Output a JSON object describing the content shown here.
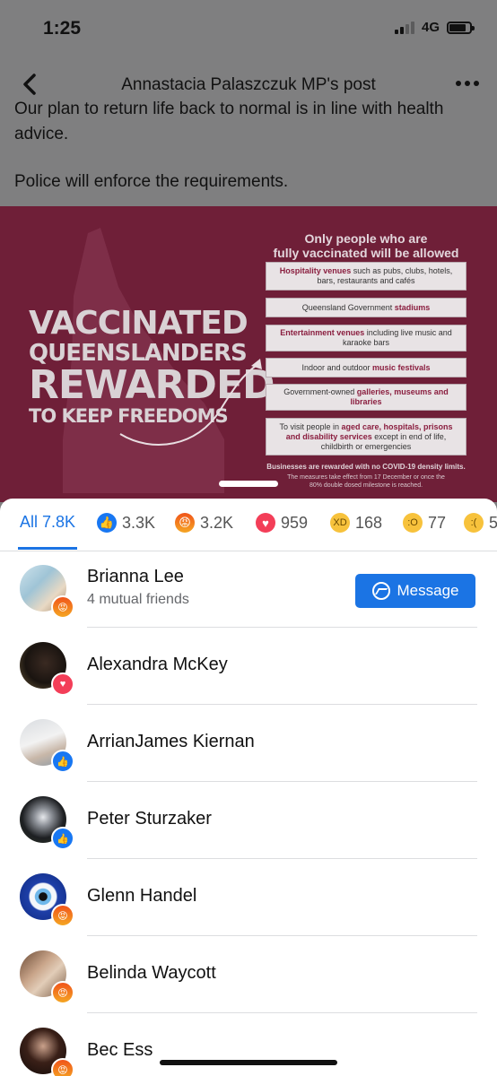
{
  "status": {
    "time": "1:25",
    "network": "4G"
  },
  "header": {
    "title": "Annastacia Palaszczuk MP's post"
  },
  "post": {
    "text_cut": "Our plan to return life back to normal is in line with health advice.",
    "text_2": "Police will enforce the requirements."
  },
  "image": {
    "headline": [
      "VACCINATED",
      "QUEENSLANDERS",
      "REWARDED",
      "TO KEEP FREEDOMS"
    ],
    "only_title_1": "Only people who are",
    "only_title_2": "fully vaccinated will be allowed in:",
    "boxes": [
      {
        "bold": "Hospitality venues",
        "rest": " such as pubs, clubs, hotels, bars, restaurants and cafés"
      },
      {
        "bold": "",
        "pre": "Queensland Government ",
        "bold2": "stadiums"
      },
      {
        "bold": "Entertainment venues",
        "rest": " including live music and karaoke bars"
      },
      {
        "pre": "Indoor and outdoor ",
        "bold2": "music festivals"
      },
      {
        "pre": "Government-owned ",
        "bold2": "galleries, museums and libraries"
      },
      {
        "pre": "To visit people in ",
        "bold2": "aged care, hospitals, prisons and disability services",
        "rest": " except in end of life, childbirth or emergencies"
      }
    ],
    "footer_1": "Businesses are rewarded with no COVID-19 density limits.",
    "footer_2": "The measures take effect from 17 December or once the 80% double dosed milestone is reached."
  },
  "tabs": {
    "all": "All 7.8K",
    "like": "3.3K",
    "angry": "3.2K",
    "love": "959",
    "haha": "168",
    "wow": "77",
    "sad": "5"
  },
  "people": [
    {
      "name": "Brianna Lee",
      "sub": "4 mutual friends",
      "reaction": "angry",
      "button": "Message"
    },
    {
      "name": "Alexandra McKey",
      "reaction": "love"
    },
    {
      "name": "ArrianJames Kiernan",
      "reaction": "like"
    },
    {
      "name": "Peter Sturzaker",
      "reaction": "like"
    },
    {
      "name": "Glenn Handel",
      "reaction": "angry"
    },
    {
      "name": "Belinda Waycott",
      "reaction": "angry"
    },
    {
      "name": "Bec Ess",
      "reaction": "angry"
    }
  ],
  "colors": {
    "accent": "#1b74e4",
    "image_bg": "#6f1f38",
    "dim": "#7f7f80"
  }
}
